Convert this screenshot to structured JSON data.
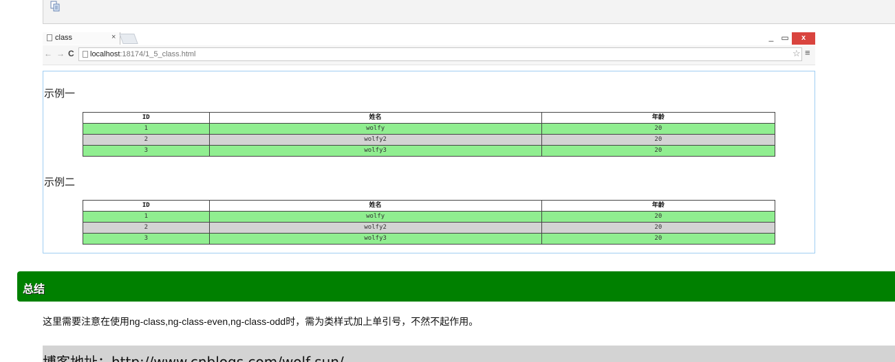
{
  "code_toolbar": {
    "copy_icon": "copy-icon"
  },
  "browser": {
    "tab": {
      "title": "class",
      "close": "×"
    },
    "window_controls": {
      "minimize": "_",
      "maximize": "▭",
      "close": "x"
    },
    "nav": {
      "back": "←",
      "forward": "→",
      "reload": "C"
    },
    "url": {
      "host": "localhost",
      "path": ":18174/1_5_class.html"
    },
    "icons": {
      "star": "☆",
      "menu": "≡"
    },
    "examples": [
      {
        "heading": "示例一",
        "columns": [
          "ID",
          "姓名",
          "年龄"
        ],
        "rows": [
          {
            "id": "1",
            "name": "wolfy",
            "age": "20"
          },
          {
            "id": "2",
            "name": "wolfy2",
            "age": "20"
          },
          {
            "id": "3",
            "name": "wolfy3",
            "age": "20"
          }
        ]
      },
      {
        "heading": "示例二",
        "columns": [
          "ID",
          "姓名",
          "年龄"
        ],
        "rows": [
          {
            "id": "1",
            "name": "wolfy",
            "age": "20"
          },
          {
            "id": "2",
            "name": "wolfy2",
            "age": "20"
          },
          {
            "id": "3",
            "name": "wolfy3",
            "age": "20"
          }
        ]
      }
    ],
    "colors": {
      "odd_row": "#90ee90",
      "even_row": "#d3d3d3",
      "viewport_border": "#9fcdf2"
    }
  },
  "summary": {
    "title": "总结",
    "note": "这里需要注意在使用ng-class,ng-class-even,ng-class-odd时，需为类样式加上单引号，不然不起作用。",
    "color": "#008000"
  },
  "blog": {
    "text": "博客地址：http://www.cnblogs.com/wolf-sun/"
  }
}
